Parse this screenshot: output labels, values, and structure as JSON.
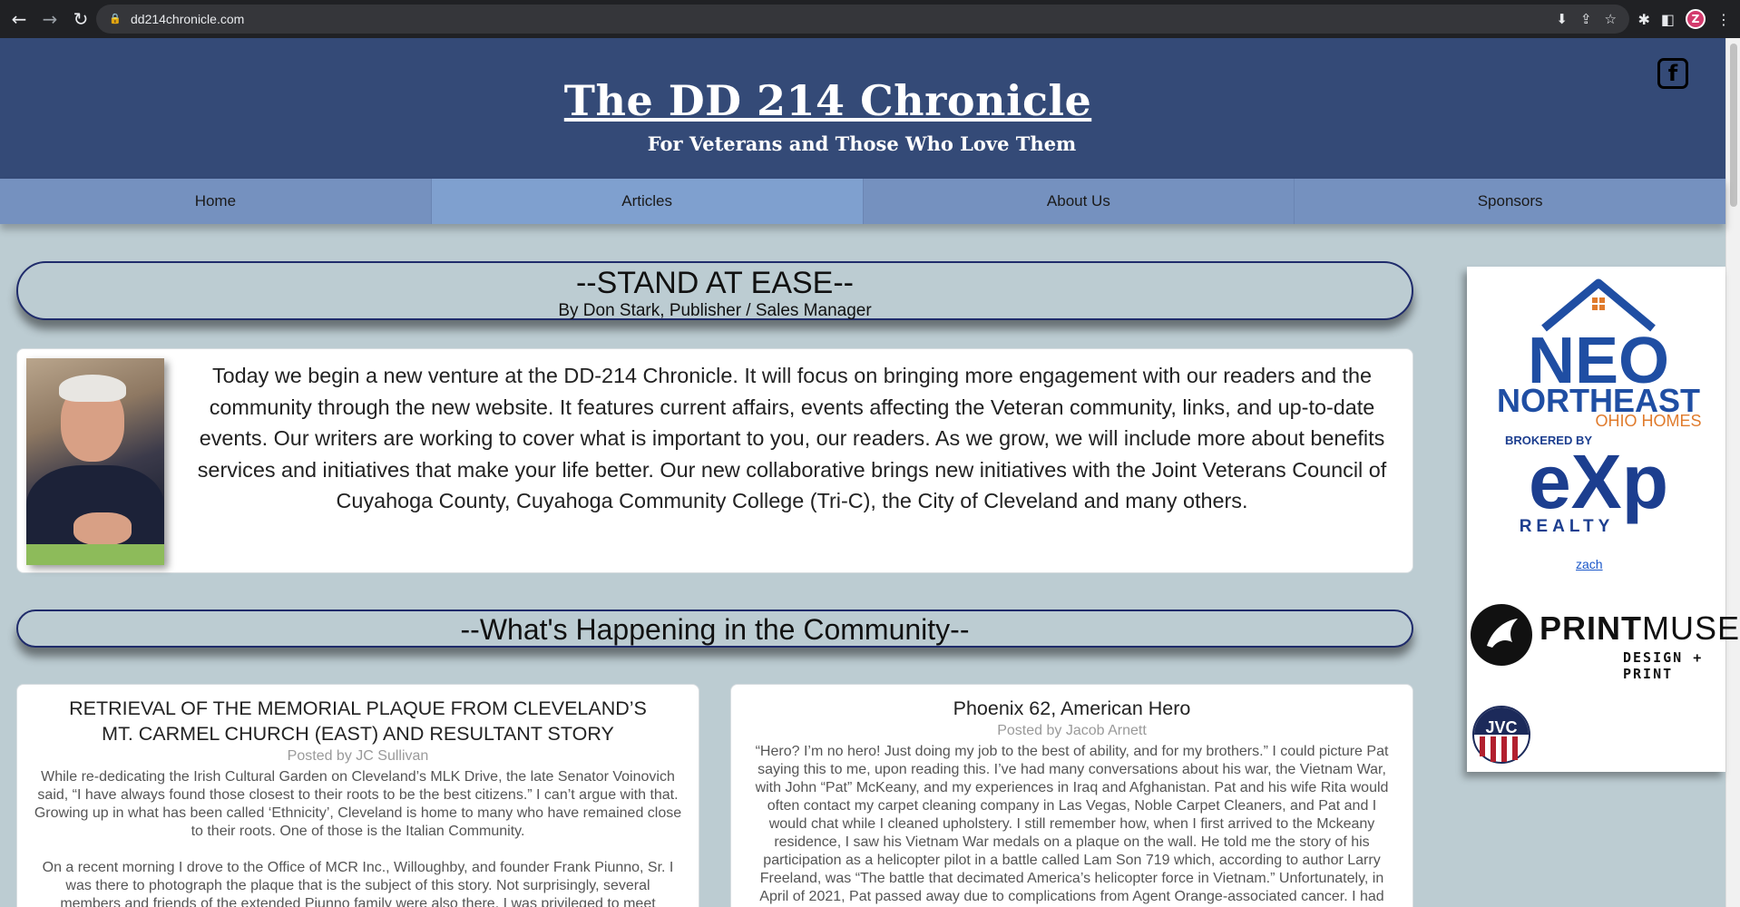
{
  "browser": {
    "url": "dd214chronicle.com",
    "profile_initial": "Z"
  },
  "header": {
    "title": "The DD 214 Chronicle",
    "tagline": "For Veterans and Those Who Love Them",
    "facebook_glyph": "f"
  },
  "nav": {
    "items": [
      {
        "label": "Home"
      },
      {
        "label": "Articles"
      },
      {
        "label": "About Us"
      },
      {
        "label": "Sponsors"
      }
    ]
  },
  "feature": {
    "title": "--STAND AT EASE--",
    "byline": "By Don Stark, Publisher / Sales Manager",
    "body": "Today we begin a new venture at the DD-214 Chronicle. It will focus on bringing more engagement with our readers and the community through the new website. It features current affairs, events affecting the Veteran community, links, and up-to-date events. Our writers are working to cover what is important to you, our readers. As we grow, we will include more about benefits services and initiatives that make your life better. Our new collaborative brings new initiatives with the Joint Veterans Council of Cuyahoga County, Cuyahoga Community College (Tri-C), the City of Cleveland and many others."
  },
  "community": {
    "heading": "--What's Happening in the Community--",
    "articles": [
      {
        "title": "RETRIEVAL OF THE MEMORIAL PLAQUE FROM CLEVELAND’S MT. CARMEL CHURCH (EAST) AND RESULTANT STORY",
        "posted_by": "Posted by JC Sullivan",
        "paragraphs": [
          "While re-dedicating the Irish Cultural Garden on Cleveland’s MLK Drive, the late Senator Voinovich said, “I have always found those closest to their roots to be the best citizens.” I can’t argue with that. Growing up in what has been called ‘Ethnicity’, Cleveland is home to many who have remained close to their roots. One of those is the Italian Community.",
          "On a recent morning I drove to the Office of MCR Inc., Willoughby, and founder Frank Piunno, Sr. I was there to photograph the plaque that is the subject of this story. Not surprisingly, several members and friends of the extended Piunno family were also there. I was privileged to meet"
        ]
      },
      {
        "title": "Phoenix 62, American Hero",
        "posted_by": "Posted by Jacob Arnett",
        "paragraphs": [
          "“Hero? I’m no hero! Just doing my job to the best of ability, and for my brothers.” I could picture Pat saying this to me, upon reading this. I’ve had many conversations about his war, the Vietnam War, with John “Pat” McKeany, and my experiences in Iraq and Afghanistan. Pat and his wife Rita would often contact my carpet cleaning company in Las Vegas, Noble Carpet Cleaners, and Pat and I would chat while I cleaned upholstery. I still remember how, when I first arrived to the Mckeany residence, I saw his Vietnam War medals on a plaque on the wall. He told me the story of his participation as a helicopter pilot in a battle called Lam Son 719 which, according to author Larry Freeland, was “The battle that decimated America’s helicopter force in Vietnam.” Unfortunately, in April of 2021, Pat passed away due to complications from Agent Orange-associated cancer. I had"
        ]
      }
    ]
  },
  "sponsors": {
    "neo_line1": "NEO",
    "neo_line2": "NORTHEAST",
    "neo_line3": "OHIO HOMES",
    "exp_brokered": "BROKERED BY",
    "exp_mark": "eXp",
    "exp_realty": "REALTY",
    "broken_alt": "zach",
    "printmuse_print": "PRINT",
    "printmuse_muse": "MUSE",
    "printmuse_tag": "DESIGN + PRINT",
    "jvc_mark": "JVC"
  },
  "colors": {
    "header_bg": "#344a77",
    "nav_bg": "#7591bf",
    "page_bg": "#bcccd2",
    "banner_border": "#1f2b6b",
    "neo_blue": "#1f4ea3",
    "neo_orange": "#e07b2c",
    "exp_blue": "#1c3e8f"
  }
}
